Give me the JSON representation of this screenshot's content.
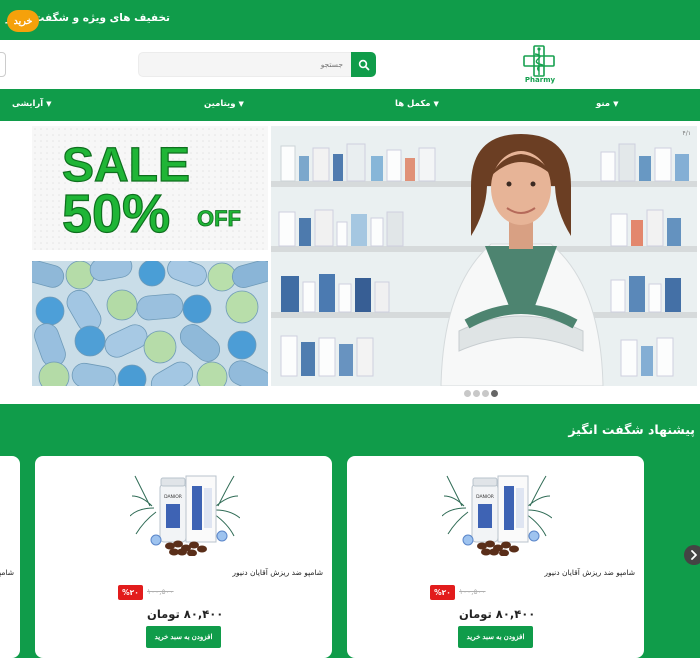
{
  "topbar": {
    "promo": "تخفیف های ویژه و شگفت انگیز",
    "buy_label": "خرید"
  },
  "header": {
    "search_placeholder": "جستجو",
    "logo_text": "Pharmy"
  },
  "nav": {
    "items": [
      {
        "label": "منو"
      },
      {
        "label": "مکمل ها"
      },
      {
        "label": "ویتامین"
      },
      {
        "label": "آرایشی"
      }
    ]
  },
  "hero": {
    "sale_line1": "SALE",
    "sale_line2": "50%",
    "sale_line3": "OFF",
    "slide_counter": "۴/۱"
  },
  "deals": {
    "title": "پیشنهاد شگفت انگیز",
    "products": [
      {
        "brand": "DANIOR",
        "name": "شامپو ضد ریزش آقایان دنیور",
        "discount": "%۲۰",
        "old_price": "۱۰۰,۵۰۰",
        "price": "۸۰,۴۰۰ تومان",
        "add_label": "افزودن به سبد خرید"
      },
      {
        "brand": "DANIOR",
        "name": "شامپو ضد ریزش آقایان دنیور",
        "discount": "%۲۰",
        "old_price": "۱۰۰,۵۰۰",
        "price": "۸۰,۴۰۰ تومان",
        "add_label": "افزودن به سبد خرید"
      }
    ],
    "edge_card_name": "شامپو"
  },
  "colors": {
    "brand_green": "#109c4a",
    "accent_orange": "#f5a10b",
    "discount_red": "#e21c1c"
  }
}
